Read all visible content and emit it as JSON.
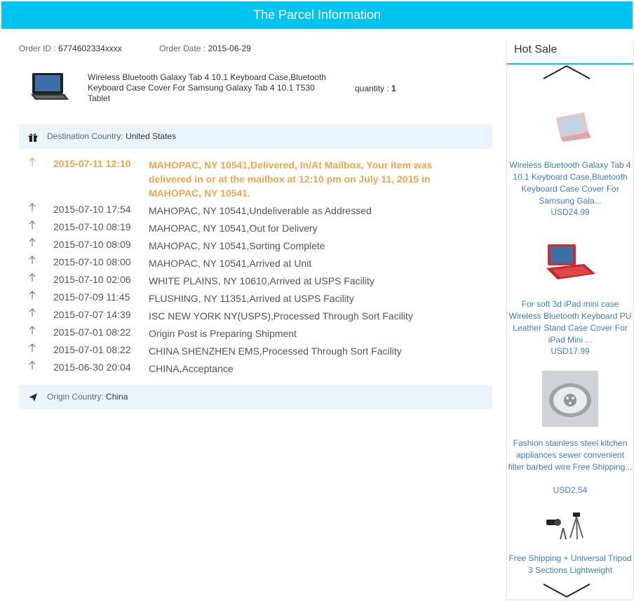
{
  "header": {
    "title": "The Parcel Information"
  },
  "order": {
    "id_label": "Order ID : ",
    "id_value": "6774602334xxxx",
    "date_label": "Order Date : ",
    "date_value": "2015-06-29"
  },
  "product": {
    "name": "Wireless Bluetooth Galaxy Tab 4 10.1 Keyboard Case,Bluetooth Keyboard Case Cover For Samsung Galaxy Tab 4 10.1 T530 Tablet",
    "qty_label": "quantity : ",
    "qty_value": "1"
  },
  "destination": {
    "label": "Destination Country: ",
    "value": "United States"
  },
  "origin": {
    "label": "Origin Country: ",
    "value": "China"
  },
  "tracking": [
    {
      "time": "2015-07-11 12:10",
      "desc": "MAHOPAC, NY 10541,Delivered, In/At Mailbox, Your item was delivered in or at the mailbox at 12:10 pm on July 11, 2015 in MAHOPAC, NY 10541."
    },
    {
      "time": "2015-07-10 17:54",
      "desc": "MAHOPAC, NY 10541,Undeliverable as Addressed"
    },
    {
      "time": "2015-07-10 08:19",
      "desc": "MAHOPAC, NY 10541,Out for Delivery"
    },
    {
      "time": "2015-07-10 08:09",
      "desc": "MAHOPAC, NY 10541,Sorting Complete"
    },
    {
      "time": "2015-07-10 08:00",
      "desc": "MAHOPAC, NY 10541,Arrived at Unit"
    },
    {
      "time": "2015-07-10 02:06",
      "desc": "WHITE PLAINS, NY 10610,Arrived at USPS Facility"
    },
    {
      "time": "2015-07-09 11:45",
      "desc": "FLUSHING, NY 11351,Arrived at USPS Facility"
    },
    {
      "time": "2015-07-07 14:39",
      "desc": "ISC NEW YORK NY(USPS),Processed Through Sort Facility"
    },
    {
      "time": "2015-07-01 08:22",
      "desc": "Origin Post is Preparing Shipment"
    },
    {
      "time": "2015-07-01 08:22",
      "desc": "CHINA SHENZHEN EMS,Processed Through Sort Facility"
    },
    {
      "time": "2015-06-30 20:04",
      "desc": "CHINA,Acceptance"
    }
  ],
  "hot_sale": {
    "title": "Hot Sale",
    "items": [
      {
        "name": "Wireless Bluetooth Galaxy Tab 4 10.1 Keyboard Case,Bluetooth Keyboard Case Cover For Samsung Gala...",
        "price": "USD24.99"
      },
      {
        "name": "For soft 3d iPad mini case Wireless Bluetooth Keyboard PU Leather Stand Case Cover For iPad Mini ...",
        "price": "USD17.99"
      },
      {
        "name": "Fashion stainless steel kitchen appliances sewer convenient filter barbed wire Free Shipping...",
        "price": "USD2.54"
      },
      {
        "name": "Free Shipping + Universal Tripod 3 Sections Lightweight",
        "price": ""
      }
    ]
  },
  "colors": {
    "header_bg": "#00c3f0",
    "highlight": "#f0a64a",
    "link": "#3a7fc4",
    "bar_bg": "#eaf4fc"
  }
}
